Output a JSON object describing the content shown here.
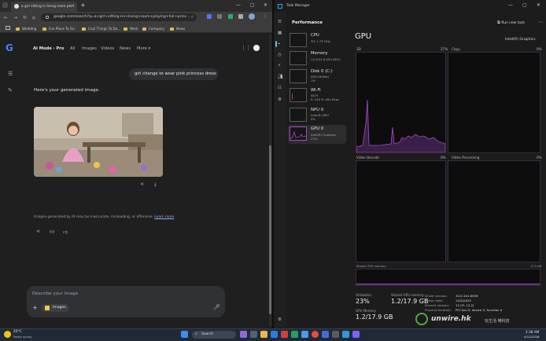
{
  "browser": {
    "tab_title": "a girl sitting in living room plo",
    "new_tab": "+",
    "url": "google.com/search?q=a+girl+sitting+in+living+room+playing+her+princ...",
    "bookmarks": [
      "Wedding",
      "Fun Place To Go",
      "Cool Things To Do...",
      "Work",
      "Company",
      "News"
    ]
  },
  "google": {
    "mode": "AI Mode",
    "mode_sub": "Pro",
    "tabs": [
      "All",
      "Images",
      "Videos",
      "News",
      "More"
    ],
    "user_prompt": "girl change to wear pink princess dress",
    "response_text": "Here's your generated image.",
    "disclaimer": "Images generated by AI may be inaccurate, misleading, or offensive.",
    "learn_more": "Learn more",
    "input_placeholder": "Describe your image",
    "images_chip": "Images"
  },
  "taskmanager": {
    "app_title": "Task Manager",
    "section": "Performance",
    "run_new_task": "Run new task",
    "devices": [
      {
        "name": "CPU",
        "sub": "3% 1.73 GHz"
      },
      {
        "name": "Memory",
        "sub": "14.3/31.6 GB (45%)"
      },
      {
        "name": "Disk 0 (C:)",
        "sub": "SSD (NVMe)",
        "sub2": "1%"
      },
      {
        "name": "Wi-Fi",
        "sub": "Wi-Fi",
        "sub2": "S: 240 R: 464 Kbps"
      },
      {
        "name": "NPU 0",
        "sub": "Intel(R) NPU",
        "sub2": "0%"
      },
      {
        "name": "GPU 0",
        "sub": "Intel(R) Graphics",
        "sub2": "23%"
      }
    ],
    "gpu_title": "GPU",
    "gpu_model": "Intel(R) Graphics",
    "graphs": [
      {
        "label": "3D",
        "pct": "27%"
      },
      {
        "label": "Copy",
        "pct": "0%"
      },
      {
        "label": "Video Decode",
        "pct": "0%"
      },
      {
        "label": "Video Processing",
        "pct": "0%"
      }
    ],
    "shared_mem_label": "Shared GPU memory",
    "shared_mem_max": "17.9 GB",
    "utilization_label": "Utilization",
    "utilization": "23%",
    "shared_gpu_memory_label": "Shared GPU memory",
    "shared_gpu_memory": "1.2/17.9 GB",
    "gpu_memory_label": "GPU Memory",
    "gpu_memory": "1.2/17.9 GB",
    "details": [
      {
        "k": "Driver version:",
        "v": "32.0.101.8559"
      },
      {
        "k": "Driver date:",
        "v": "12/5/2025"
      },
      {
        "k": "DirectX version:",
        "v": "12 (FL 12.2)"
      },
      {
        "k": "Physical location:",
        "v": "PCI bus 0, device 2, function 0"
      }
    ],
    "watermark": "unwire.hk",
    "watermark_cn": "玩生活·樂科技"
  },
  "taskbar": {
    "weather_temp": "20°C",
    "weather_desc": "Partly sunny",
    "search": "Search",
    "time": "2:38 AM",
    "date": "4/12/2026"
  },
  "colors": {
    "gpu_accent": "#a349c8",
    "chrome_bg": "#1f1f1f",
    "tm_bg": "#1c1c1c"
  }
}
